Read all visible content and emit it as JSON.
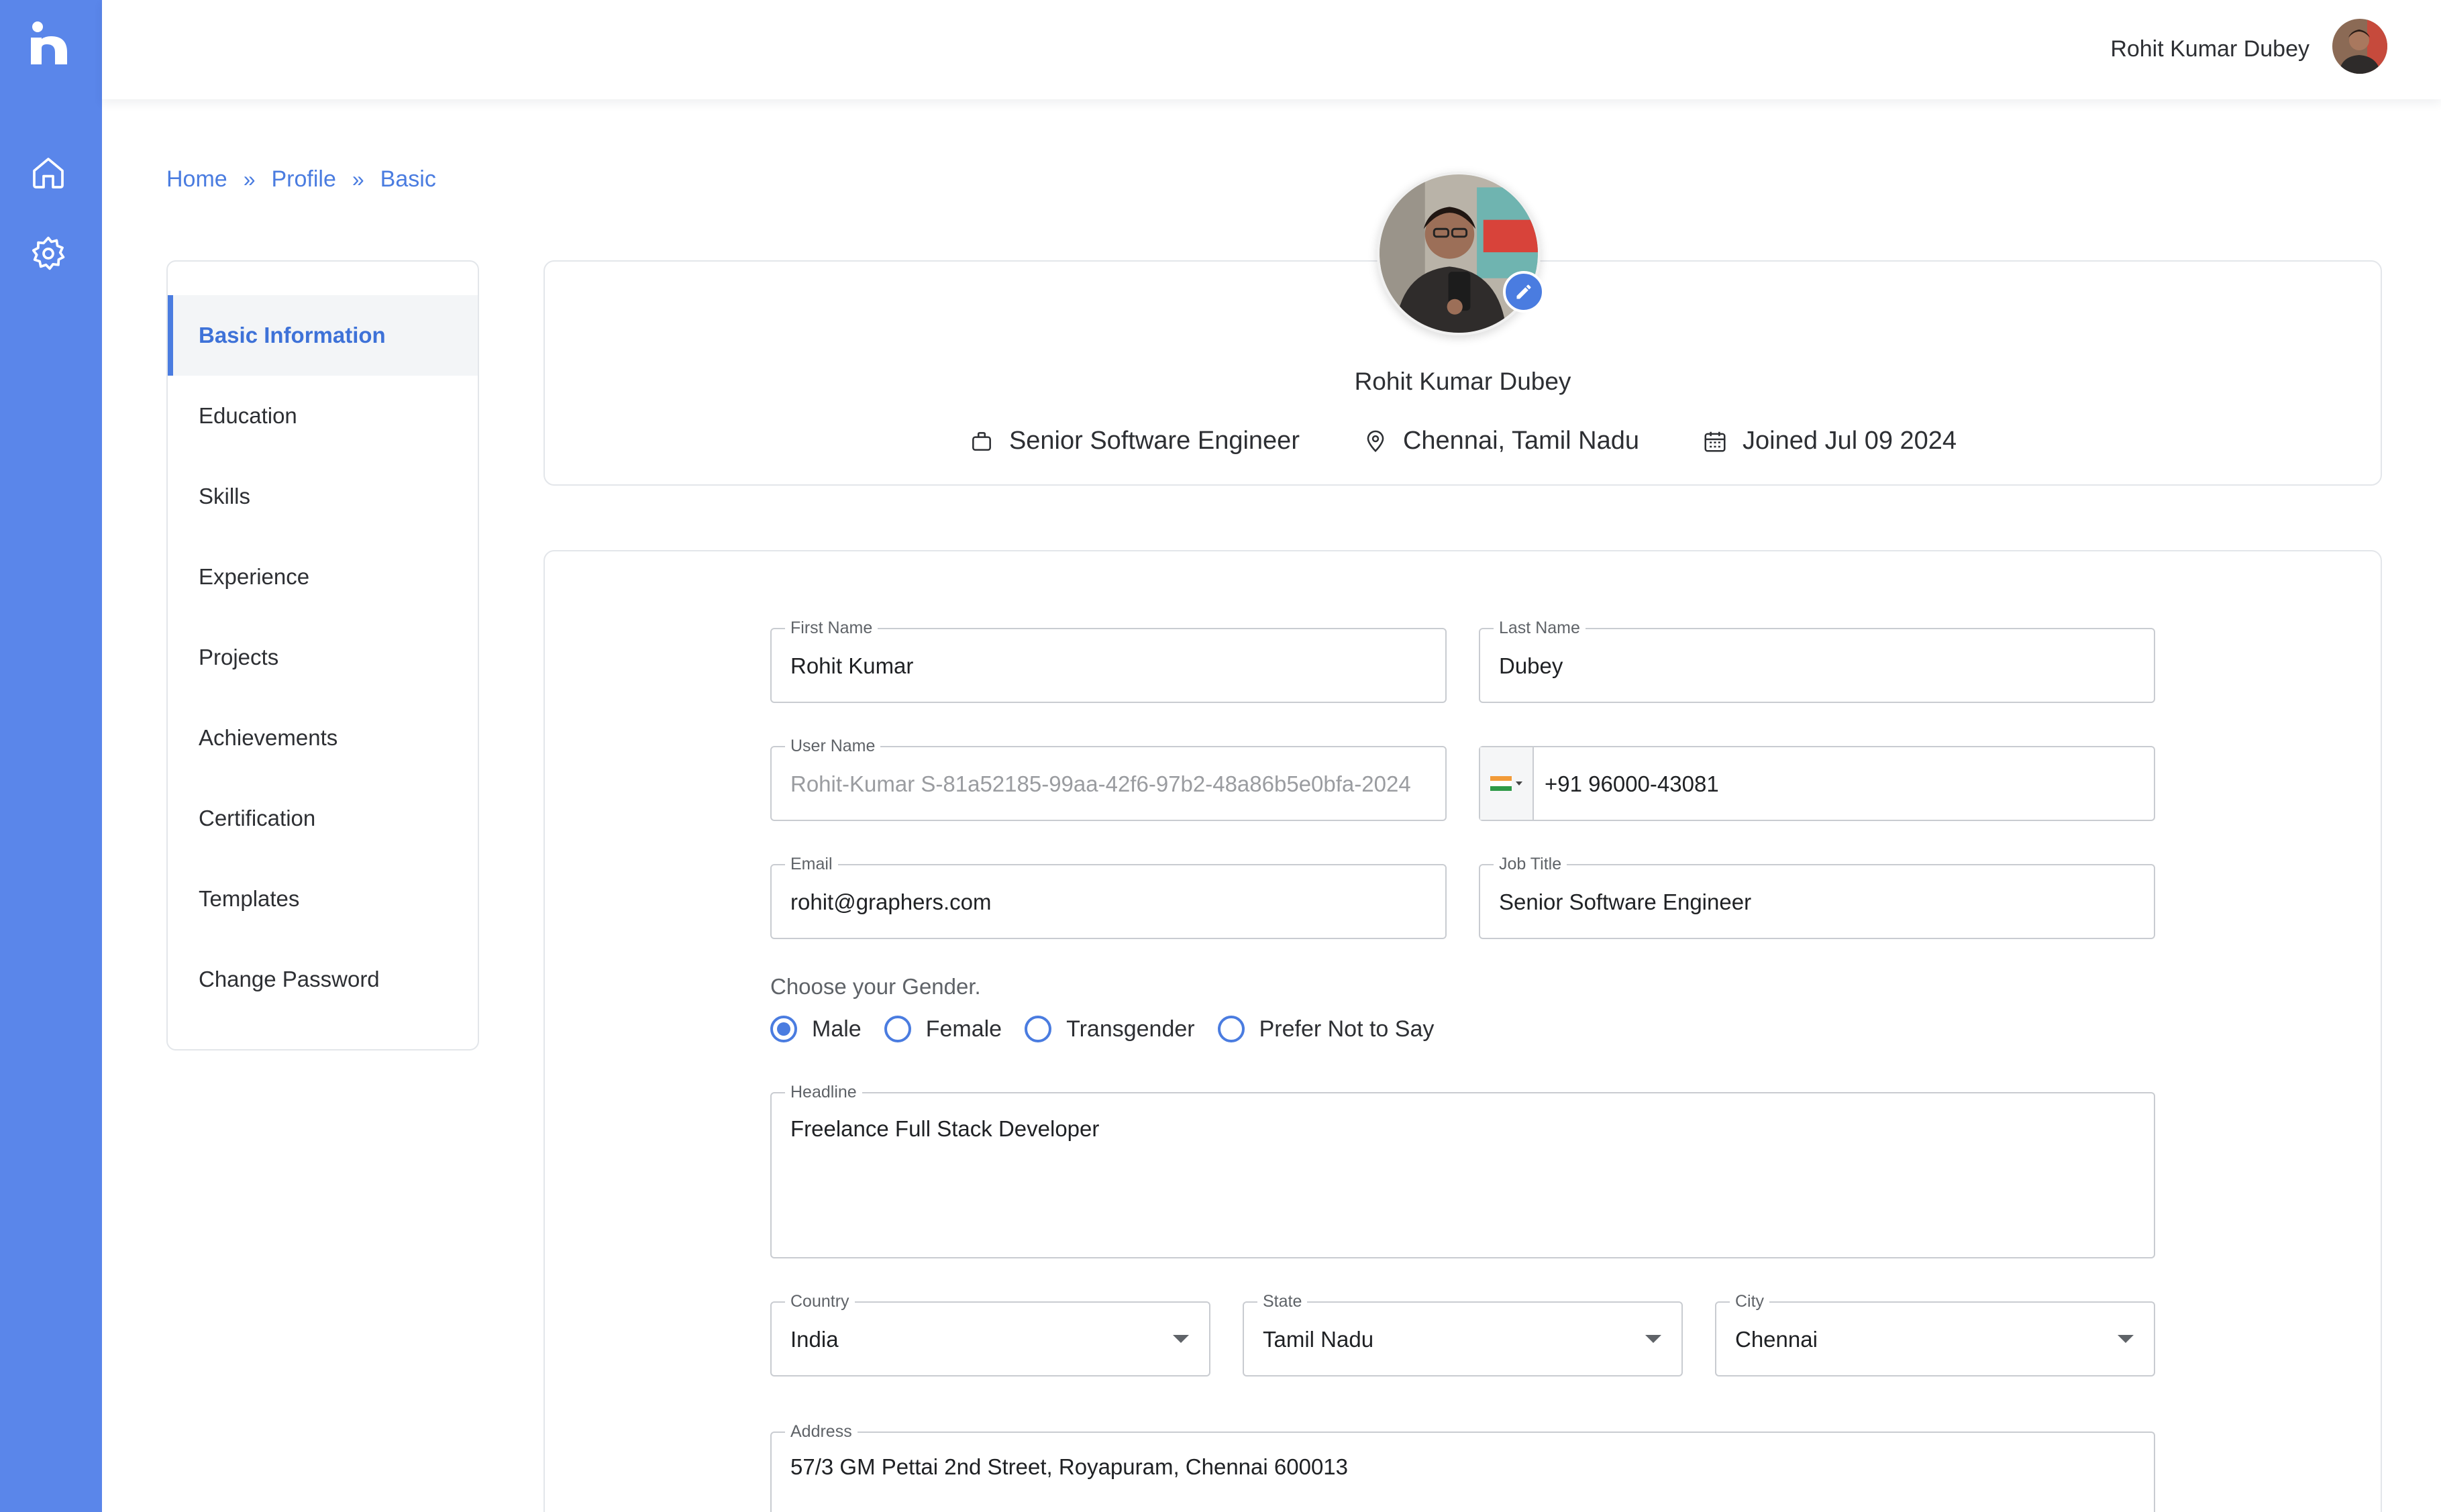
{
  "header": {
    "user_name": "Rohit Kumar Dubey"
  },
  "breadcrumb": {
    "items": [
      "Home",
      "Profile",
      "Basic"
    ],
    "separator": "»"
  },
  "side_menu": {
    "items": [
      {
        "label": "Basic Information",
        "active": true
      },
      {
        "label": "Education"
      },
      {
        "label": "Skills"
      },
      {
        "label": "Experience"
      },
      {
        "label": "Projects"
      },
      {
        "label": "Achievements"
      },
      {
        "label": "Certification"
      },
      {
        "label": "Templates"
      },
      {
        "label": "Change Password"
      }
    ]
  },
  "profile": {
    "name": "Rohit Kumar Dubey",
    "job_title": "Senior Software Engineer",
    "location": "Chennai, Tamil Nadu",
    "joined": "Joined Jul 09 2024"
  },
  "form": {
    "first_name": {
      "label": "First Name",
      "value": "Rohit Kumar"
    },
    "last_name": {
      "label": "Last Name",
      "value": "Dubey"
    },
    "user_name": {
      "label": "User Name",
      "value": "Rohit-Kumar S-81a52185-99aa-42f6-97b2-48a86b5e0bfa-2024"
    },
    "phone": {
      "value": "+91 96000-43081"
    },
    "email": {
      "label": "Email",
      "value": "rohit@graphers.com"
    },
    "job_title": {
      "label": "Job Title",
      "value": "Senior Software Engineer"
    },
    "gender": {
      "title": "Choose your Gender.",
      "options": [
        "Male",
        "Female",
        "Transgender",
        "Prefer Not to Say"
      ],
      "selected": "Male"
    },
    "headline": {
      "label": "Headline",
      "value": "Freelance Full Stack Developer"
    },
    "country": {
      "label": "Country",
      "value": "India"
    },
    "state": {
      "label": "State",
      "value": "Tamil Nadu"
    },
    "city": {
      "label": "City",
      "value": "Chennai"
    },
    "address": {
      "label": "Address",
      "value": "57/3 GM Pettai 2nd Street, Royapuram, Chennai 600013"
    }
  },
  "colors": {
    "rail": "#5a86ea",
    "accent": "#4a7ce0",
    "border": "#c9ccd1"
  },
  "icons": {
    "logo": "app-logo-icon",
    "nav": [
      "home-icon",
      "gear-icon"
    ],
    "meta": [
      "briefcase-icon",
      "location-pin-icon",
      "calendar-icon"
    ],
    "edit": "pencil-icon"
  }
}
